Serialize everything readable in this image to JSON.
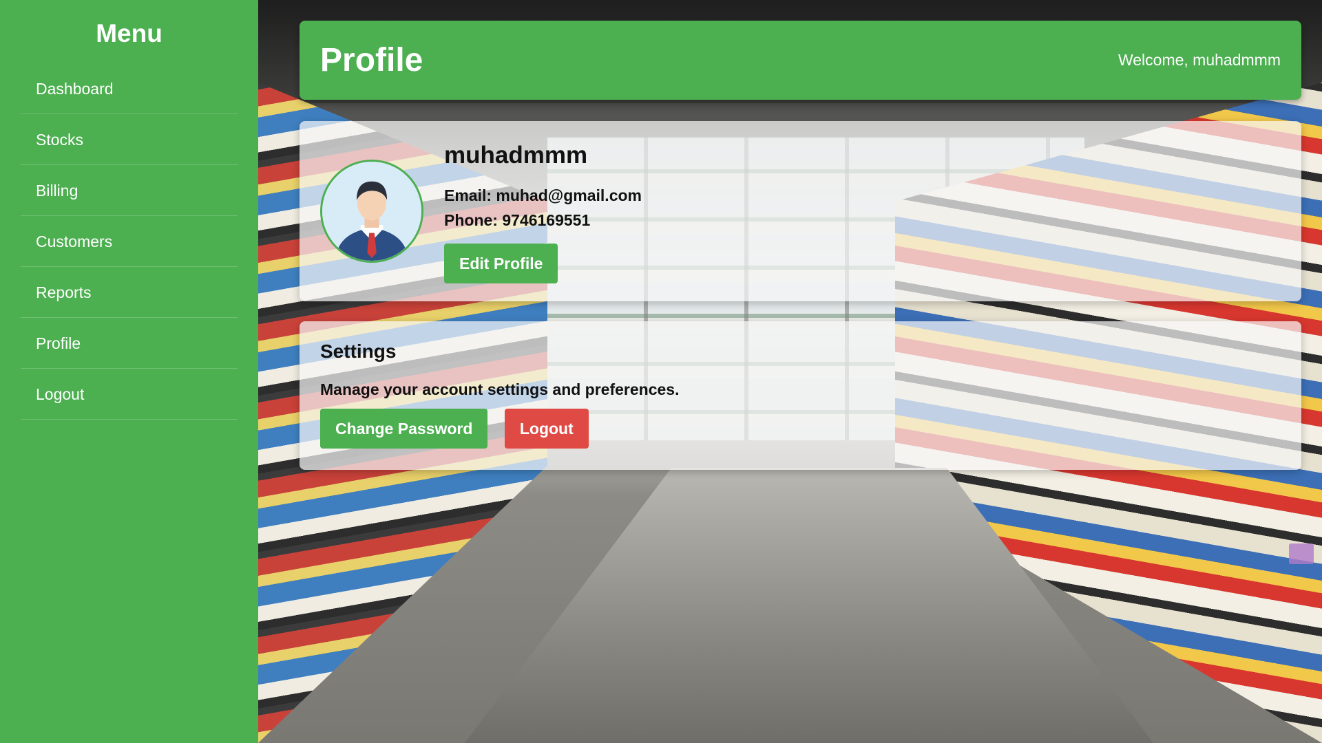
{
  "sidebar": {
    "title": "Menu",
    "items": [
      {
        "label": "Dashboard"
      },
      {
        "label": "Stocks"
      },
      {
        "label": "Billing"
      },
      {
        "label": "Customers"
      },
      {
        "label": "Reports"
      },
      {
        "label": "Profile"
      },
      {
        "label": "Logout"
      }
    ]
  },
  "header": {
    "title": "Profile",
    "welcome": "Welcome, muhadmmm"
  },
  "profile": {
    "username": "muhadmmm",
    "email": "Email: muhad@gmail.com",
    "phone": "Phone: 9746169551",
    "edit_label": "Edit Profile",
    "avatar_icon": "user-avatar-icon"
  },
  "settings": {
    "title": "Settings",
    "description": "Manage your account settings and preferences.",
    "change_password_label": "Change Password",
    "logout_label": "Logout"
  },
  "colors": {
    "primary": "#4caf50",
    "danger": "#df4b44",
    "text": "#111111"
  }
}
